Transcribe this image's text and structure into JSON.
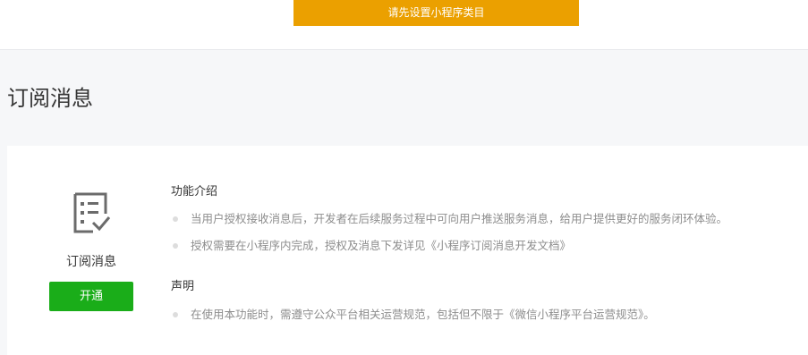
{
  "top_notice": {
    "label": "请先设置小程序类目"
  },
  "page": {
    "title": "订阅消息"
  },
  "feature": {
    "icon": "checklist-document-icon",
    "name": "订阅消息",
    "enable_label": "开通"
  },
  "intro": {
    "title": "功能介绍",
    "items": [
      "当用户授权接收消息后，开发者在后续服务过程中可向用户推送服务消息，给用户提供更好的服务闭环体验。",
      "授权需要在小程序内完成，授权及消息下发详见《小程序订阅消息开发文档》"
    ]
  },
  "declaration": {
    "title": "声明",
    "items": [
      "在使用本功能时，需遵守公众平台相关运营规范，包括但不限于《微信小程序平台运营规范》。"
    ]
  },
  "colors": {
    "notice_bg": "#eba000",
    "enable_bg": "#1aad19",
    "page_bg": "#f6f7f9"
  }
}
